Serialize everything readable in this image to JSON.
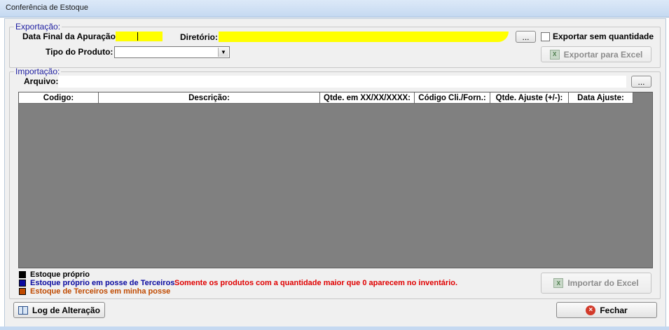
{
  "window": {
    "title": "Conferência de Estoque"
  },
  "export": {
    "legend": "Exportação:",
    "data_final_label": "Data Final da Apuração:",
    "diretorio_label": "Diretório:",
    "browse_label": "...",
    "sem_quantidade_label": "Exportar sem quantidade",
    "tipo_produto_label": "Tipo do Produto:",
    "tipo_produto_value": "",
    "export_excel_label": "Exportar para Excel"
  },
  "import": {
    "legend": "Importação:",
    "arquivo_label": "Arquivo:",
    "browse_label": "...",
    "import_excel_label": "Importar do Excel"
  },
  "grid": {
    "columns": [
      "Codigo:",
      "Descrição:",
      "Qtde. em XX/XX/XXXX:",
      "Código Cli./Forn.:",
      "Qtde. Ajuste (+/-):",
      "Data Ajuste:"
    ]
  },
  "legend_items": [
    {
      "label": "Estoque próprio",
      "color": "#000000"
    },
    {
      "label": "Estoque próprio em posse de Terceiros",
      "color": "#0a0aa0"
    },
    {
      "label": "Estoque de Terceiros em minha posse",
      "color": "#c04a00"
    }
  ],
  "notice": "Somente os produtos com a quantidade maior que 0 aparecem no inventário.",
  "footer": {
    "log_label": "Log de Alteração",
    "fechar_label": "Fechar"
  },
  "colors": {
    "highlight": "#ffff00",
    "grid_bg": "#808080",
    "notice": "#e00000",
    "legend_title": "#1c1ca0"
  }
}
